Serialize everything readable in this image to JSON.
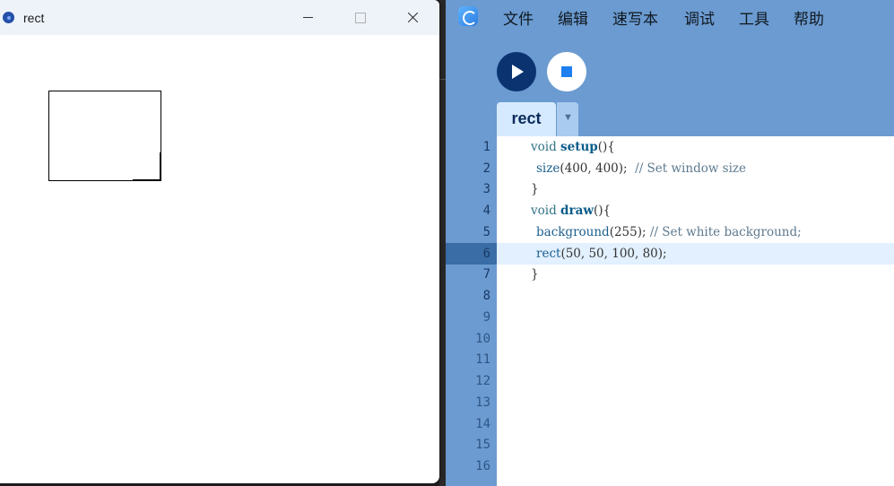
{
  "sketch_window": {
    "title": "rect",
    "controls": {
      "minimize": "minimize-icon",
      "maximize": "maximize-icon",
      "close": "close-icon"
    }
  },
  "ide": {
    "menu": [
      "文件",
      "编辑",
      "速写本",
      "调试",
      "工具",
      "帮助"
    ],
    "toolbar": {
      "run": "play-icon",
      "stop": "stop-icon"
    },
    "tab": {
      "label": "rect",
      "dropdown": "▼"
    },
    "line_numbers": [
      "1",
      "2",
      "3",
      "4",
      "5",
      "6",
      "7",
      "8",
      "9",
      "10",
      "11",
      "12",
      "13",
      "14",
      "15",
      "16"
    ],
    "current_line": "6",
    "code": {
      "l1": {
        "kw": "void",
        "fn": "setup",
        "rest": "(){"
      },
      "l2": {
        "call": "size",
        "args": "(400, 400);",
        "comment": "// Set window size"
      },
      "l3": {
        "text": "}"
      },
      "l4": {
        "kw": "void",
        "fn": "draw",
        "rest": "(){"
      },
      "l5": {
        "call": "background",
        "args": "(255);",
        "comment": "// Set white background;"
      },
      "l6": {
        "call": "rect",
        "args": "(50, 50, 100, 80);"
      },
      "l7": {
        "text": "}"
      }
    }
  },
  "colors": {
    "ide_bg": "#6b9bd1",
    "run_button": "#0a3370",
    "stop_square": "#1e7ff0",
    "line_highlight": "#e2f0ff"
  }
}
